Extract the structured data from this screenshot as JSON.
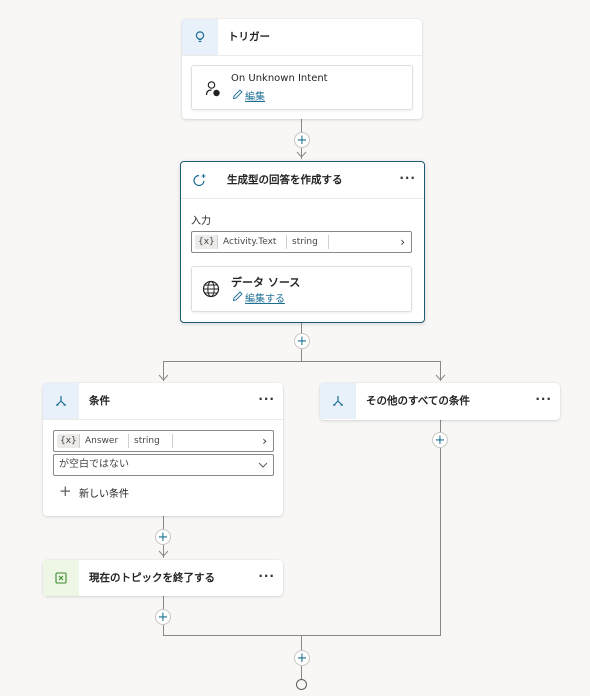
{
  "trigger": {
    "title": "トリガー",
    "intent_name": "On Unknown Intent",
    "edit_label": "編集"
  },
  "generative": {
    "title": "生成型の回答を作成する",
    "input_label": "入力",
    "var_prefix": "{x}",
    "var_name": "Activity.Text",
    "var_type": "string",
    "ds_title": "データ ソース",
    "ds_edit": "編集する"
  },
  "condition": {
    "title": "条件",
    "var_prefix": "{x}",
    "var_name": "Answer",
    "var_type": "string",
    "operator": "が空白ではない",
    "new_condition": "新しい条件"
  },
  "else_branch": {
    "title": "その他のすべての条件"
  },
  "end_topic": {
    "title": "現在のトピックを終了する"
  },
  "common": {
    "more": "···",
    "plus": "+"
  },
  "colors": {
    "accent": "#1f6f94",
    "selected_border": "#1f5c74",
    "trigger_header": "#e8f1fa",
    "end_header": "#eef7e6"
  }
}
